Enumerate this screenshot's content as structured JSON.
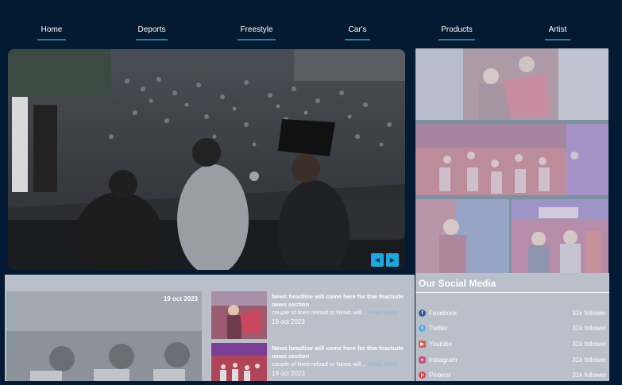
{
  "nav": {
    "items": [
      {
        "label": "Home"
      },
      {
        "label": "Deports"
      },
      {
        "label": "Freestyle"
      },
      {
        "label": "Car's"
      },
      {
        "label": "Products"
      },
      {
        "label": "Artist"
      }
    ]
  },
  "hero": {
    "prev_icon": "chevron-left-icon",
    "next_icon": "chevron-right-icon"
  },
  "news": {
    "feature_date": "19 oct 2023",
    "items": [
      {
        "headline": "News headline will come here for thw feactude news section",
        "excerpt": "couple of lines reload to News will...",
        "read_more": "Read More",
        "date": "19 oct 2023"
      },
      {
        "headline": "News headline will come here for thw feactude news section",
        "excerpt": "couple of lines reload to News will...",
        "read_more": "Read More",
        "date": "19 oct 2023"
      }
    ]
  },
  "social": {
    "title": "Our Social Media",
    "items": [
      {
        "name": "Facebook",
        "count": "31k follower",
        "icon": "facebook-icon",
        "color": "#3b5998"
      },
      {
        "name": "Twitter",
        "count": "31k follower",
        "icon": "twitter-icon",
        "color": "#5aa9e6"
      },
      {
        "name": "Youtube",
        "count": "31k follower",
        "icon": "youtube-icon",
        "color": "#e0554a"
      },
      {
        "name": "Instagram",
        "count": "31k follower",
        "icon": "instagram-icon",
        "color": "#c8507a"
      },
      {
        "name": "Pinterst",
        "count": "31k follower",
        "icon": "pinterest-icon",
        "color": "#d64545"
      }
    ]
  }
}
